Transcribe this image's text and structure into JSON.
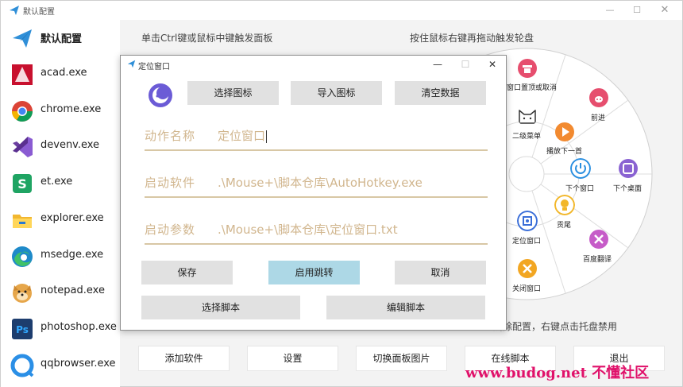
{
  "main": {
    "title": "默认配置",
    "hint_left": "单击Ctrl键或鼠标中键触发面板",
    "hint_right": "按住鼠标右键再拖动触发轮盘",
    "bottom_hint": "删除配置，右键点击托盘禁用"
  },
  "sidebar": {
    "items": [
      {
        "label": "默认配置",
        "icon": "paper-plane-icon",
        "color": "#2f8fd8"
      },
      {
        "label": "acad.exe",
        "icon": "autocad-icon",
        "color": "#c8102e"
      },
      {
        "label": "chrome.exe",
        "icon": "chrome-icon",
        "color": "#4285f4"
      },
      {
        "label": "devenv.exe",
        "icon": "visual-studio-icon",
        "color": "#6b3fa0"
      },
      {
        "label": "et.exe",
        "icon": "wps-sheet-icon",
        "color": "#1fa463"
      },
      {
        "label": "explorer.exe",
        "icon": "folder-icon",
        "color": "#f2b730"
      },
      {
        "label": "msedge.exe",
        "icon": "edge-icon",
        "color": "#1e8ac9"
      },
      {
        "label": "notepad.exe",
        "icon": "doge-icon",
        "color": "#e6a64a"
      },
      {
        "label": "photoshop.exe",
        "icon": "photoshop-icon",
        "color": "#1d3d6e"
      },
      {
        "label": "qqbrowser.exe",
        "icon": "qqbrowser-icon",
        "color": "#2b8fe6"
      }
    ]
  },
  "wheel": {
    "items": [
      {
        "label": "窗口置顶或取消",
        "icon": "pin-icon",
        "color": "#e64e6e"
      },
      {
        "label": "前进",
        "icon": "pig-icon",
        "color": "#e64e6e"
      },
      {
        "label": "二级菜单",
        "icon": "cat-icon",
        "color": "#333333"
      },
      {
        "label": "播放下一首",
        "icon": "play-icon",
        "color": "#f28a30"
      },
      {
        "label": "下个窗口",
        "icon": "power-icon",
        "color": "#2a8fe0"
      },
      {
        "label": "下个桌面",
        "icon": "desktop-icon",
        "color": "#8a63d2"
      },
      {
        "label": "贡尾",
        "icon": "bulb-icon",
        "color": "#f2b72a"
      },
      {
        "label": "定位窗口",
        "icon": "locate-icon",
        "color": "#3a6ed8"
      },
      {
        "label": "百度翻译",
        "icon": "translate-icon",
        "color": "#c65cc8"
      },
      {
        "label": "关闭窗口",
        "icon": "close-window-icon",
        "color": "#f2a622"
      }
    ]
  },
  "bottom_buttons": [
    "添加软件",
    "设置",
    "切换面板图片",
    "在线脚本",
    "退出"
  ],
  "watermark": "www.budog.net 不懂社区",
  "dialog": {
    "title": "定位窗口",
    "buttons_top": [
      "选择图标",
      "导入图标",
      "清空数据"
    ],
    "fields": [
      {
        "label": "动作名称",
        "value": "定位窗口"
      },
      {
        "label": "启动软件",
        "value": ".\\Mouse+\\脚本仓库\\AutoHotkey.exe"
      },
      {
        "label": "启动参数",
        "value": ".\\Mouse+\\脚本仓库\\定位窗口.txt"
      }
    ],
    "save": "保存",
    "enable_jump": "启用跳转",
    "cancel": "取消",
    "choose_script": "选择脚本",
    "edit_script": "编辑脚本"
  },
  "colors": {
    "accent_field": "#d1b68e",
    "primary_button": "#add8e6",
    "watermark": "#e0116a"
  }
}
